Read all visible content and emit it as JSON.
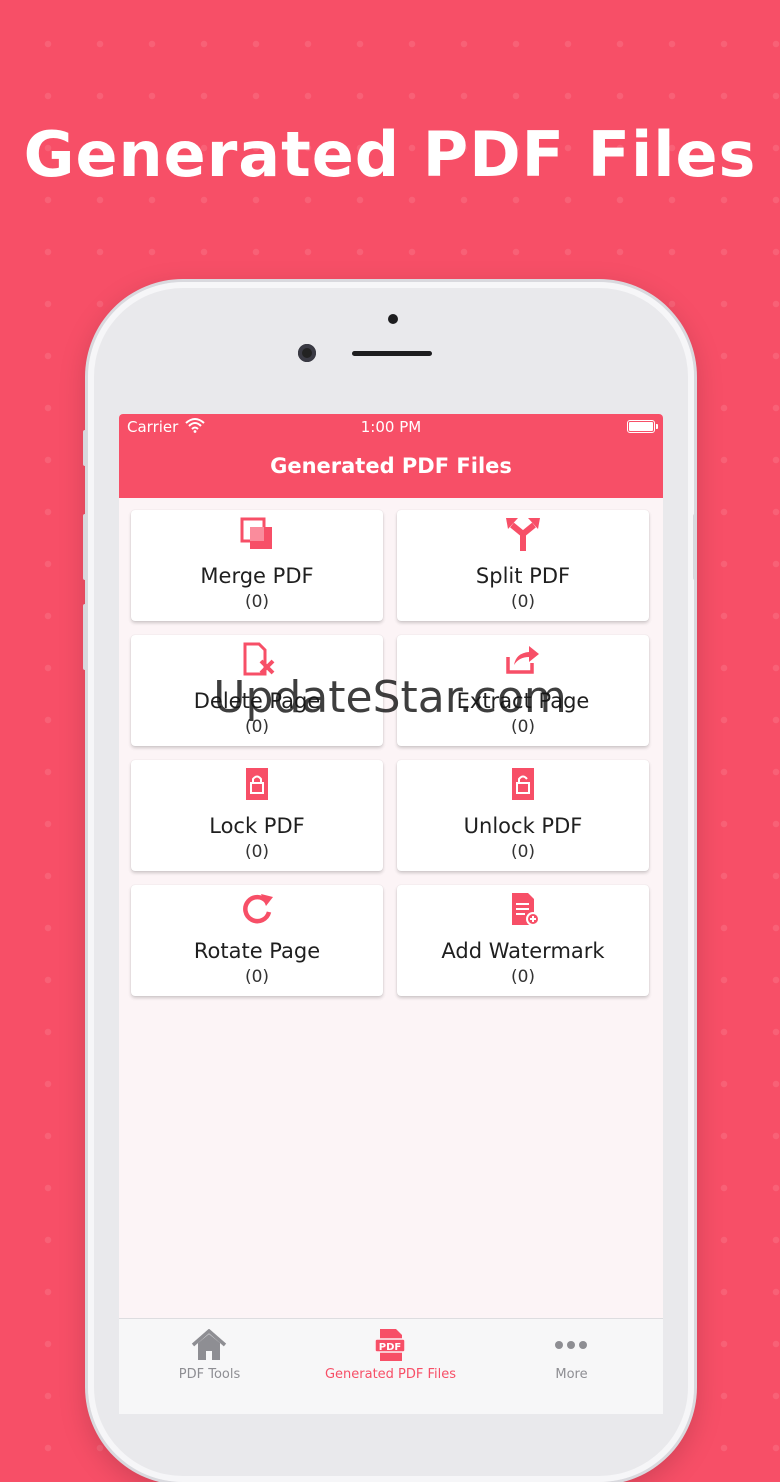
{
  "headline": "Generated PDF Files",
  "status_bar": {
    "carrier": "Carrier",
    "time": "1:00 PM"
  },
  "nav_title": "Generated PDF Files",
  "tiles": [
    {
      "name": "Merge PDF",
      "count": "(0)",
      "icon": "merge-icon"
    },
    {
      "name": "Split PDF",
      "count": "(0)",
      "icon": "split-icon"
    },
    {
      "name": "Delete Page",
      "count": "(0)",
      "icon": "delete-page-icon"
    },
    {
      "name": "Extract Page",
      "count": "(0)",
      "icon": "extract-page-icon"
    },
    {
      "name": "Lock PDF",
      "count": "(0)",
      "icon": "lock-icon"
    },
    {
      "name": "Unlock PDF",
      "count": "(0)",
      "icon": "unlock-icon"
    },
    {
      "name": "Rotate Page",
      "count": "(0)",
      "icon": "rotate-icon"
    },
    {
      "name": "Add Watermark",
      "count": "(0)",
      "icon": "watermark-icon"
    }
  ],
  "tabs": [
    {
      "label": "PDF Tools",
      "icon": "home-icon",
      "active": false
    },
    {
      "label": "Generated PDF Files",
      "icon": "pdf-icon",
      "active": true,
      "icon_text": "PDF"
    },
    {
      "label": "More",
      "icon": "more-icon",
      "active": false
    }
  ],
  "watermark": "UpdateStar.com",
  "colors": {
    "accent": "#f74f67",
    "inactive": "#8e8e93",
    "screen_bg": "#fcf4f6"
  }
}
